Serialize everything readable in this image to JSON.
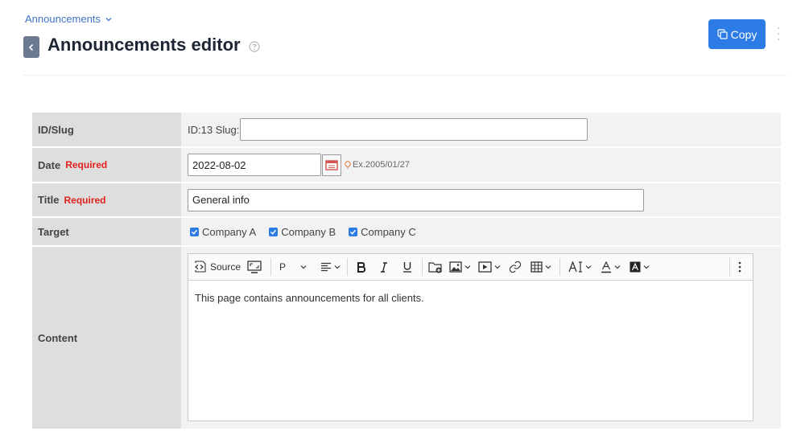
{
  "breadcrumb": {
    "label": "Announcements"
  },
  "page": {
    "title": "Announcements editor"
  },
  "actions": {
    "copy_label": "Copy"
  },
  "form": {
    "id_slug": {
      "label": "ID/Slug",
      "id_prefix": "ID:13 Slug:",
      "slug_value": ""
    },
    "date": {
      "label": "Date",
      "required": "Required",
      "value": "2022-08-02",
      "hint": "Ex.2005/01/27"
    },
    "title": {
      "label": "Title",
      "required": "Required",
      "value": "General info"
    },
    "target": {
      "label": "Target",
      "options": [
        {
          "label": "Company A",
          "checked": true
        },
        {
          "label": "Company B",
          "checked": true
        },
        {
          "label": "Company C",
          "checked": true
        }
      ]
    },
    "content": {
      "label": "Content",
      "text": "This page contains announcements for all clients."
    }
  },
  "editor_toolbar": {
    "source_label": "Source",
    "paragraph_label": "P"
  },
  "colors": {
    "accent": "#2d7be5",
    "required": "#e0211b",
    "label_bg": "#dedede",
    "value_bg": "#f2f2f2"
  }
}
